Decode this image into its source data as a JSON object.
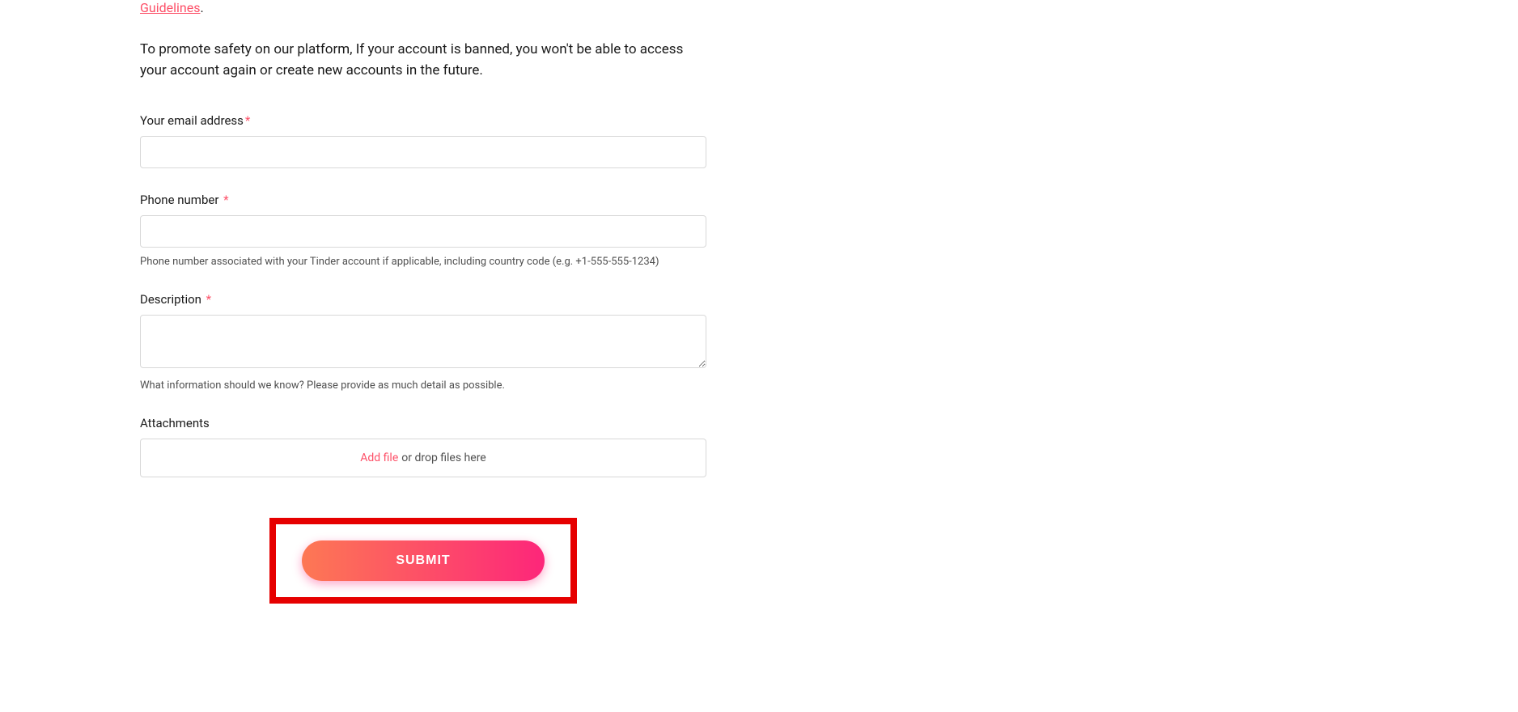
{
  "intro": {
    "guidelines_link": "Guidelines",
    "period": ".",
    "safety_text": "To promote safety on our platform, If your account is banned, you won't be able to access your account again or create new accounts in the future."
  },
  "form": {
    "email": {
      "label": "Your email address",
      "value": ""
    },
    "phone": {
      "label": "Phone number",
      "value": "",
      "hint": "Phone number associated with your Tinder account if applicable, including country code (e.g. +1-555-555-1234)"
    },
    "description": {
      "label": "Description",
      "value": "",
      "hint": "What information should we know? Please provide as much detail as possible."
    },
    "attachments": {
      "label": "Attachments",
      "add_file": "Add file",
      "drop_text": " or drop files here"
    },
    "submit_label": "SUBMIT"
  }
}
